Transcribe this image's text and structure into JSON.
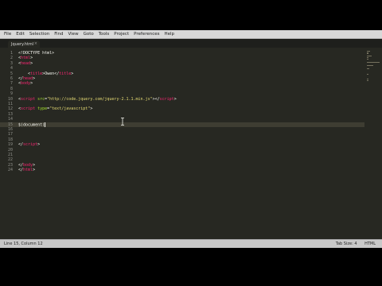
{
  "menubar": {
    "items": [
      "File",
      "Edit",
      "Selection",
      "Find",
      "View",
      "Goto",
      "Tools",
      "Project",
      "Preferences",
      "Help"
    ]
  },
  "tab": {
    "title": "Jquery.html",
    "close": "×"
  },
  "editor": {
    "lines": [
      {
        "n": "1",
        "tokens": [
          [
            "c-punct",
            "<!DOCTYPE html>"
          ]
        ]
      },
      {
        "n": "2",
        "tokens": [
          [
            "c-punct",
            "<"
          ],
          [
            "c-tag",
            "html"
          ],
          [
            "c-punct",
            ">"
          ]
        ]
      },
      {
        "n": "3",
        "tokens": [
          [
            "c-punct",
            "<"
          ],
          [
            "c-tag",
            "head"
          ],
          [
            "c-punct",
            ">"
          ]
        ]
      },
      {
        "n": "4",
        "tokens": []
      },
      {
        "n": "5",
        "tokens": [
          [
            "c-text",
            "    "
          ],
          [
            "c-punct",
            "<"
          ],
          [
            "c-tag",
            "title"
          ],
          [
            "c-punct",
            ">"
          ],
          [
            "c-text",
            "Owen"
          ],
          [
            "c-punct",
            "</"
          ],
          [
            "c-tag",
            "title"
          ],
          [
            "c-punct",
            ">"
          ]
        ]
      },
      {
        "n": "6",
        "tokens": [
          [
            "c-punct",
            "</"
          ],
          [
            "c-tag",
            "head"
          ],
          [
            "c-punct",
            ">"
          ]
        ]
      },
      {
        "n": "7",
        "tokens": [
          [
            "c-punct",
            "<"
          ],
          [
            "c-tag",
            "body"
          ],
          [
            "c-punct",
            ">"
          ]
        ]
      },
      {
        "n": "8",
        "tokens": []
      },
      {
        "n": "9",
        "tokens": []
      },
      {
        "n": "10",
        "tokens": [
          [
            "c-punct",
            "<"
          ],
          [
            "c-tag",
            "script"
          ],
          [
            "c-text",
            " "
          ],
          [
            "c-attr",
            "src"
          ],
          [
            "c-punct",
            "="
          ],
          [
            "c-str",
            "\"http://code.jquery.com/jquery-2.1.1.min.js\""
          ],
          [
            "c-punct",
            "></"
          ],
          [
            "c-tag",
            "script"
          ],
          [
            "c-punct",
            ">"
          ]
        ]
      },
      {
        "n": "11",
        "tokens": []
      },
      {
        "n": "12",
        "tokens": [
          [
            "c-punct",
            "<"
          ],
          [
            "c-tag",
            "script"
          ],
          [
            "c-text",
            " "
          ],
          [
            "c-attr",
            "type"
          ],
          [
            "c-punct",
            "="
          ],
          [
            "c-str",
            "\"text/javascript\""
          ],
          [
            "c-punct",
            ">"
          ]
        ]
      },
      {
        "n": "13",
        "tokens": []
      },
      {
        "n": "14",
        "tokens": []
      },
      {
        "n": "15",
        "tokens": [
          [
            "c-text",
            "$(document)"
          ]
        ],
        "active": true,
        "cursor": true
      },
      {
        "n": "16",
        "tokens": []
      },
      {
        "n": "17",
        "tokens": []
      },
      {
        "n": "18",
        "tokens": []
      },
      {
        "n": "19",
        "tokens": [
          [
            "c-punct",
            "</"
          ],
          [
            "c-tag",
            "script"
          ],
          [
            "c-punct",
            ">"
          ]
        ]
      },
      {
        "n": "20",
        "tokens": []
      },
      {
        "n": "21",
        "tokens": []
      },
      {
        "n": "22",
        "tokens": []
      },
      {
        "n": "23",
        "tokens": [
          [
            "c-punct",
            "</"
          ],
          [
            "c-tag",
            "body"
          ],
          [
            "c-punct",
            ">"
          ]
        ]
      },
      {
        "n": "24",
        "tokens": [
          [
            "c-punct",
            "</"
          ],
          [
            "c-tag",
            "html"
          ],
          [
            "c-punct",
            ">"
          ]
        ]
      }
    ]
  },
  "status": {
    "position": "Line 15, Column 12",
    "indent": "Tab Size: 4",
    "syntax": "HTML"
  },
  "colors": {
    "background": "#272822",
    "tag": "#f92672",
    "attribute": "#a6e22e",
    "string": "#e6db74"
  }
}
